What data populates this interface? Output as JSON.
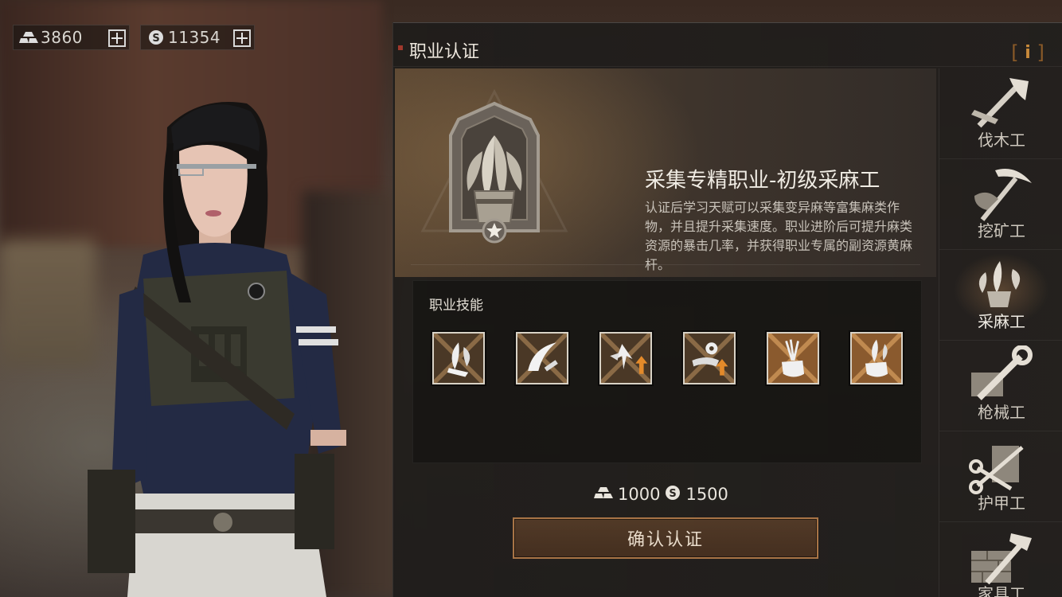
{
  "currency": {
    "gold": {
      "icon": "gold-bar-icon",
      "value": "3860"
    },
    "silver": {
      "icon": "silver-coin-icon",
      "value": "11354"
    }
  },
  "panel": {
    "title": "职业认证",
    "info_icon": "info-icon"
  },
  "job": {
    "name": "采集专精职业-初级采麻工",
    "description": "认证后学习天赋可以采集变异麻等富集麻类作物，并且提升采集速度。职业进阶后可提升麻类资源的暴击几率，并获得职业专属的副资源黄麻杆。",
    "badge_icon": "hemp-bundle-badge-icon"
  },
  "skills": {
    "label": "职业技能",
    "items": [
      {
        "icon": "hemp-sickle-icon"
      },
      {
        "icon": "sickle-blade-icon"
      },
      {
        "icon": "hemp-leaves-up-icon"
      },
      {
        "icon": "flower-up-icon"
      },
      {
        "icon": "hand-grab-bundle-icon"
      },
      {
        "icon": "hand-hold-hemp-icon"
      }
    ]
  },
  "cost": {
    "gold": "1000",
    "silver": "1500"
  },
  "confirm_label": "确认认证",
  "jobs": [
    {
      "label": "伐木工",
      "icon": "axe-icon",
      "active": false
    },
    {
      "label": "挖矿工",
      "icon": "pickaxe-icon",
      "active": false
    },
    {
      "label": "采麻工",
      "icon": "hemp-icon",
      "active": true
    },
    {
      "label": "枪械工",
      "icon": "wrench-icon",
      "active": false
    },
    {
      "label": "护甲工",
      "icon": "scissors-vest-icon",
      "active": false
    },
    {
      "label": "家具工",
      "icon": "hammer-brick-icon",
      "active": false
    }
  ],
  "colors": {
    "accent": "#a87446",
    "title_mark": "#a0382c",
    "info": "#c98a3a"
  }
}
